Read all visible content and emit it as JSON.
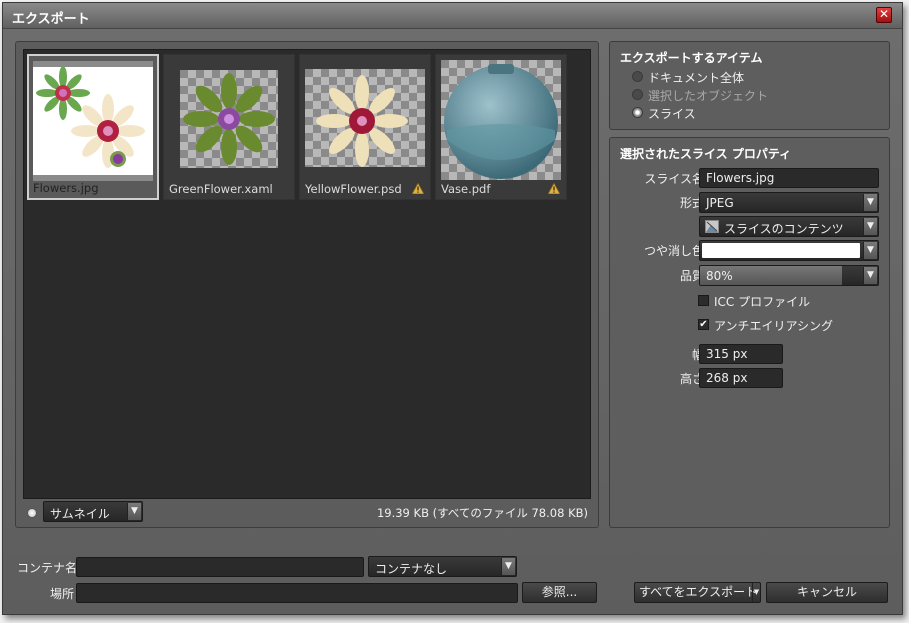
{
  "window": {
    "title": "エクスポート",
    "close_label": "✕"
  },
  "thumbnails": [
    {
      "name": "Flowers.jpg",
      "warning": false
    },
    {
      "name": "GreenFlower.xaml",
      "warning": false
    },
    {
      "name": "YellowFlower.psd",
      "warning": true
    },
    {
      "name": "Vase.pdf",
      "warning": true
    }
  ],
  "preview": {
    "view_mode": "サムネイル",
    "size_info": "19.39 KB (すべてのファイル 78.08 KB)"
  },
  "export_items": {
    "title": "エクスポートするアイテム",
    "options": [
      {
        "label": "ドキュメント全体",
        "selected": false,
        "enabled": true
      },
      {
        "label": "選択したオブジェクト",
        "selected": false,
        "enabled": false
      },
      {
        "label": "スライス",
        "selected": true,
        "enabled": true
      }
    ]
  },
  "slice_properties": {
    "title": "選択されたスライス プロパティ",
    "slice_name_label": "スライス名",
    "slice_name_value": "Flowers.jpg",
    "format_label": "形式",
    "format_value": "JPEG",
    "content_value": "スライスのコンテンツ",
    "matte_label": "つや消し色",
    "matte_color": "#ffffff",
    "quality_label": "品質",
    "quality_value": "80%",
    "quality_fraction": 0.8,
    "icc_label": "ICC プロファイル",
    "icc_checked": false,
    "antialias_label": "アンチエイリアシング",
    "antialias_checked": true,
    "width_label": "幅",
    "width_value": "315 px",
    "height_label": "高さ",
    "height_value": "268 px"
  },
  "bottom": {
    "container_label": "コンテナ名",
    "container_value": "",
    "container_type": "コンテナなし",
    "location_label": "場所",
    "location_value": "",
    "browse_label": "参照...",
    "export_all_label": "すべてをエクスポート",
    "cancel_label": "キャンセル"
  },
  "icons": {
    "close": "close-icon",
    "warning": "warning-icon",
    "dropdown": "chevron-down-icon",
    "content": "slice-content-icon"
  }
}
